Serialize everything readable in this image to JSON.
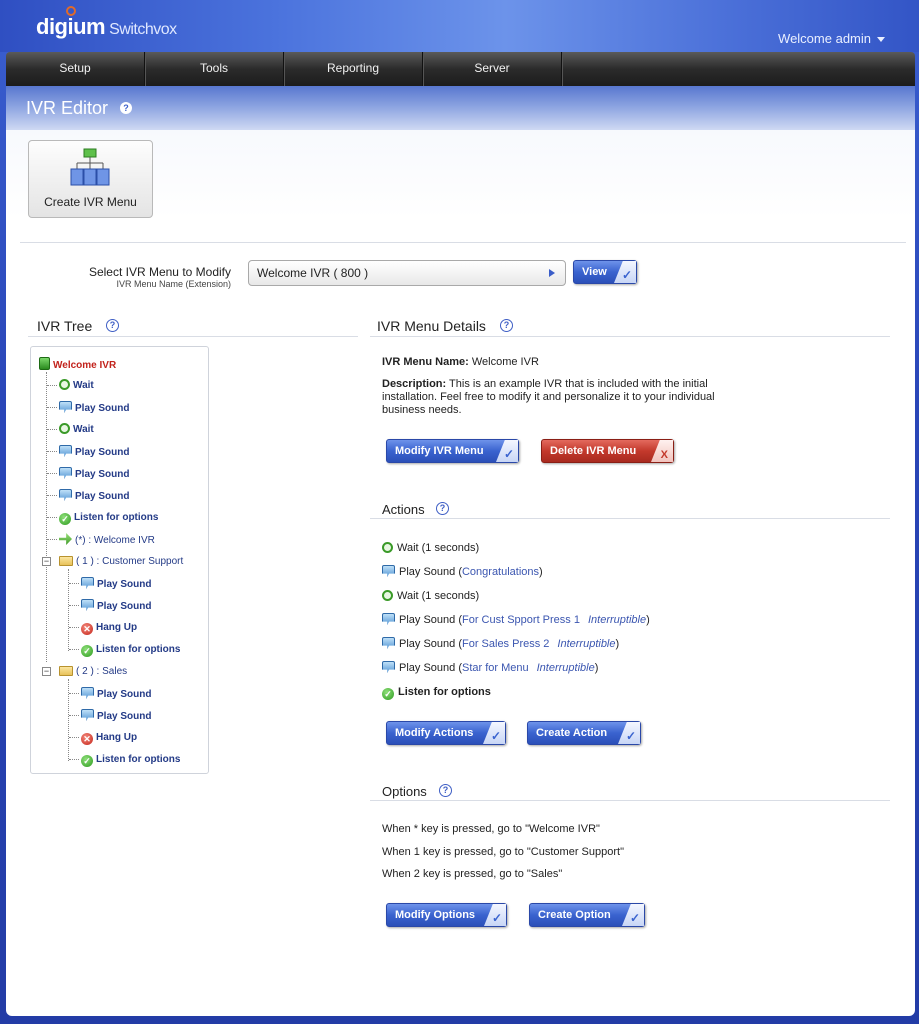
{
  "header": {
    "logo": "digium",
    "product": "Switchvox",
    "welcome": "Welcome admin"
  },
  "nav": {
    "items": [
      {
        "label": "Setup"
      },
      {
        "label": "Tools"
      },
      {
        "label": "Reporting"
      },
      {
        "label": "Server"
      }
    ]
  },
  "page": {
    "title": "IVR Editor",
    "help_glyph": "?"
  },
  "toolbar": {
    "create_label": "Create IVR Menu"
  },
  "selector": {
    "label": "Select IVR Menu to Modify",
    "sublabel": "IVR Menu Name (Extension)",
    "value": "Welcome IVR ( 800 )",
    "view_label": "View"
  },
  "tree": {
    "title": "IVR Tree",
    "root": "Welcome IVR",
    "items": [
      {
        "icon": "wait",
        "label": "Wait"
      },
      {
        "icon": "sound",
        "label": "Play Sound"
      },
      {
        "icon": "wait",
        "label": "Wait"
      },
      {
        "icon": "sound",
        "label": "Play Sound"
      },
      {
        "icon": "sound",
        "label": "Play Sound"
      },
      {
        "icon": "sound",
        "label": "Play Sound"
      },
      {
        "icon": "listen",
        "label": "Listen for options"
      },
      {
        "icon": "goto",
        "label": "(*) : Welcome IVR"
      }
    ],
    "folders": [
      {
        "label": "( 1 ) : Customer Support",
        "children": [
          {
            "icon": "sound",
            "label": "Play Sound"
          },
          {
            "icon": "sound",
            "label": "Play Sound"
          },
          {
            "icon": "hang",
            "label": "Hang Up"
          },
          {
            "icon": "listen",
            "label": "Listen for options"
          }
        ]
      },
      {
        "label": "( 2 ) : Sales",
        "children": [
          {
            "icon": "sound",
            "label": "Play Sound"
          },
          {
            "icon": "sound",
            "label": "Play Sound"
          },
          {
            "icon": "hang",
            "label": "Hang Up"
          },
          {
            "icon": "listen",
            "label": "Listen for options"
          }
        ]
      }
    ]
  },
  "details": {
    "title": "IVR Menu Details",
    "name_label": "IVR Menu Name:",
    "name_value": "Welcome IVR",
    "desc_label": "Description:",
    "desc_line1": "This is an example IVR that is included with the initial",
    "desc_line2": "installation. Feel free to modify it and personalize it to your individual",
    "desc_line3": "business needs.",
    "modify_label": "Modify IVR Menu",
    "delete_label": "Delete IVR Menu",
    "delete_glyph": "X"
  },
  "actions": {
    "title": "Actions",
    "rows": [
      {
        "icon": "wait",
        "text": "Wait (1 seconds)",
        "param": "",
        "interr": ""
      },
      {
        "icon": "sound",
        "text": "Play Sound (",
        "param": "Congratulations",
        "interr": "",
        "close": ")"
      },
      {
        "icon": "wait",
        "text": "Wait (1 seconds)",
        "param": "",
        "interr": ""
      },
      {
        "icon": "sound",
        "text": "Play Sound (",
        "param": "For Cust Spport Press 1",
        "interr": "Interruptible",
        "close": ")"
      },
      {
        "icon": "sound",
        "text": "Play Sound (",
        "param": "For Sales Press 2",
        "interr": "Interruptible",
        "close": ")"
      },
      {
        "icon": "sound",
        "text": "Play Sound (",
        "param": "Star for Menu",
        "interr": "Interruptible",
        "close": ")"
      },
      {
        "icon": "listen",
        "text": "Listen for options",
        "param": "",
        "interr": ""
      }
    ],
    "modify_label": "Modify Actions",
    "create_label": "Create Action"
  },
  "options": {
    "title": "Options",
    "rows": [
      "When * key is pressed, go to \"Welcome IVR\"",
      "When 1 key is pressed, go to \"Customer Support\"",
      "When 2 key is pressed, go to \"Sales\""
    ],
    "modify_label": "Modify Options",
    "create_label": "Create Option"
  },
  "colors": {
    "accent": "#3a63cf",
    "danger": "#c3392c",
    "tree_root": "#c2231c",
    "link": "#233a86"
  }
}
